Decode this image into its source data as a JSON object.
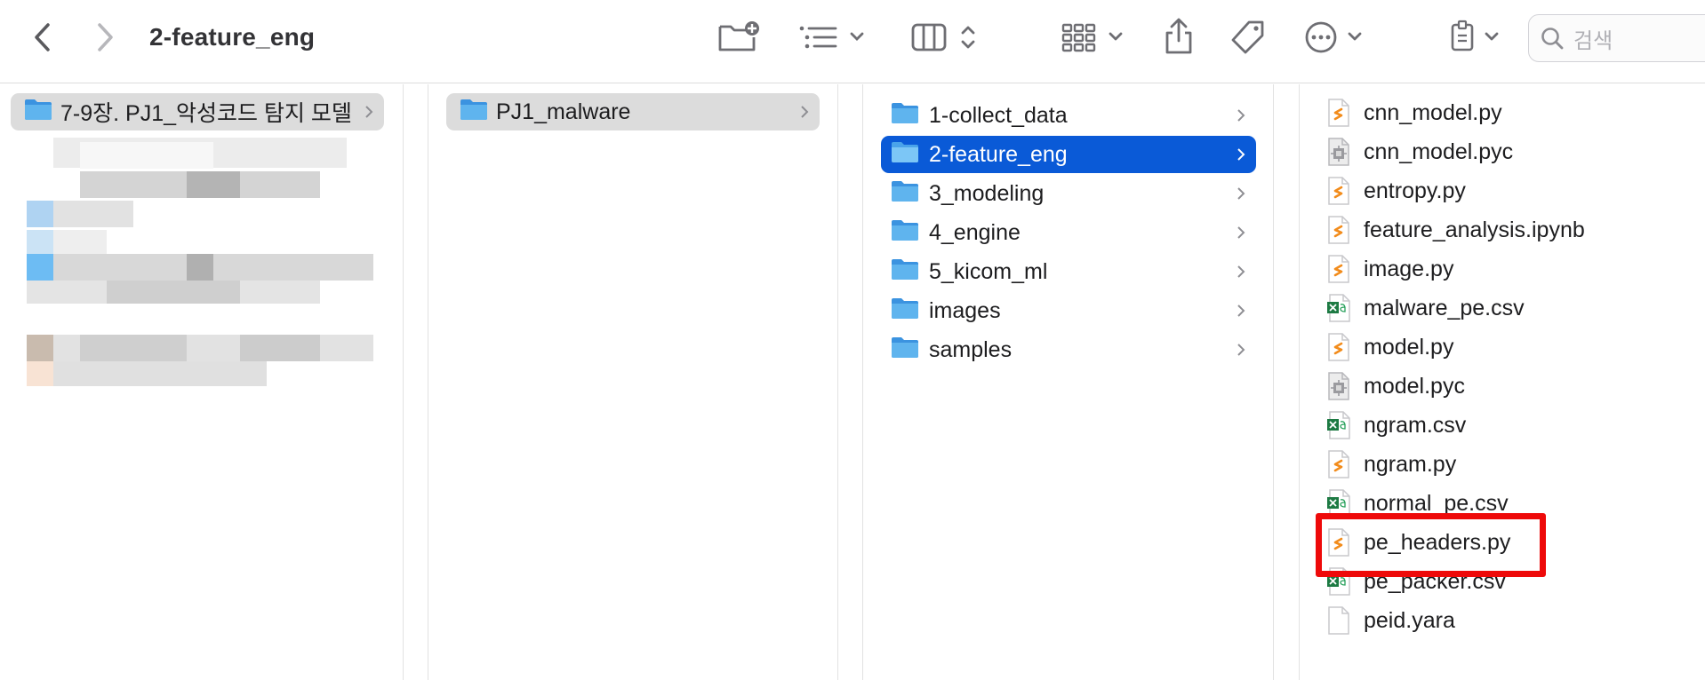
{
  "window": {
    "title": "2-feature_eng"
  },
  "toolbar": {
    "back_icon": "chevron-left-icon",
    "forward_icon": "chevron-right-icon",
    "new_folder_icon": "folder-plus-icon",
    "list_view_icon": "list-icon",
    "column_view_icon": "columns-icon",
    "group_icon": "grid-icon",
    "share_icon": "share-icon",
    "tag_icon": "tag-icon",
    "more_icon": "ellipsis-circle-icon",
    "storage_icon": "drive-icon",
    "search": {
      "placeholder": "검색"
    }
  },
  "columns": {
    "col1": {
      "items": [
        {
          "label": "7-9장. PJ1_악성코드 탐지 모델",
          "kind": "folder",
          "selected": "gray"
        }
      ]
    },
    "col2": {
      "items": [
        {
          "label": "PJ1_malware",
          "kind": "folder",
          "selected": "gray"
        }
      ]
    },
    "col3": {
      "items": [
        {
          "label": "1-collect_data",
          "kind": "folder"
        },
        {
          "label": "2-feature_eng",
          "kind": "folder",
          "selected": "blue"
        },
        {
          "label": "3_modeling",
          "kind": "folder"
        },
        {
          "label": "4_engine",
          "kind": "folder"
        },
        {
          "label": "5_kicom_ml",
          "kind": "folder"
        },
        {
          "label": "images",
          "kind": "folder"
        },
        {
          "label": "samples",
          "kind": "folder"
        }
      ]
    },
    "col4": {
      "items": [
        {
          "label": "cnn_model.py",
          "icon": "python-file-icon"
        },
        {
          "label": "cnn_model.pyc",
          "icon": "compiled-file-icon"
        },
        {
          "label": "entropy.py",
          "icon": "python-file-icon"
        },
        {
          "label": "feature_analysis.ipynb",
          "icon": "python-file-icon"
        },
        {
          "label": "image.py",
          "icon": "python-file-icon"
        },
        {
          "label": "malware_pe.csv",
          "icon": "excel-file-icon"
        },
        {
          "label": "model.py",
          "icon": "python-file-icon"
        },
        {
          "label": "model.pyc",
          "icon": "compiled-file-icon"
        },
        {
          "label": "ngram.csv",
          "icon": "excel-file-icon"
        },
        {
          "label": "ngram.py",
          "icon": "python-file-icon"
        },
        {
          "label": "normal_pe.csv",
          "icon": "excel-file-icon"
        },
        {
          "label": "pe_headers.py",
          "icon": "python-file-icon",
          "highlighted": true
        },
        {
          "label": "pe_packer.csv",
          "icon": "excel-file-icon"
        },
        {
          "label": "peid.yara",
          "icon": "plain-file-icon"
        }
      ]
    }
  },
  "colors": {
    "selection_blue": "#0a5ad7",
    "selection_gray": "#dcdcdc",
    "folder_blue": "#5fb4ee",
    "highlight_red": "#ee0a0a"
  }
}
